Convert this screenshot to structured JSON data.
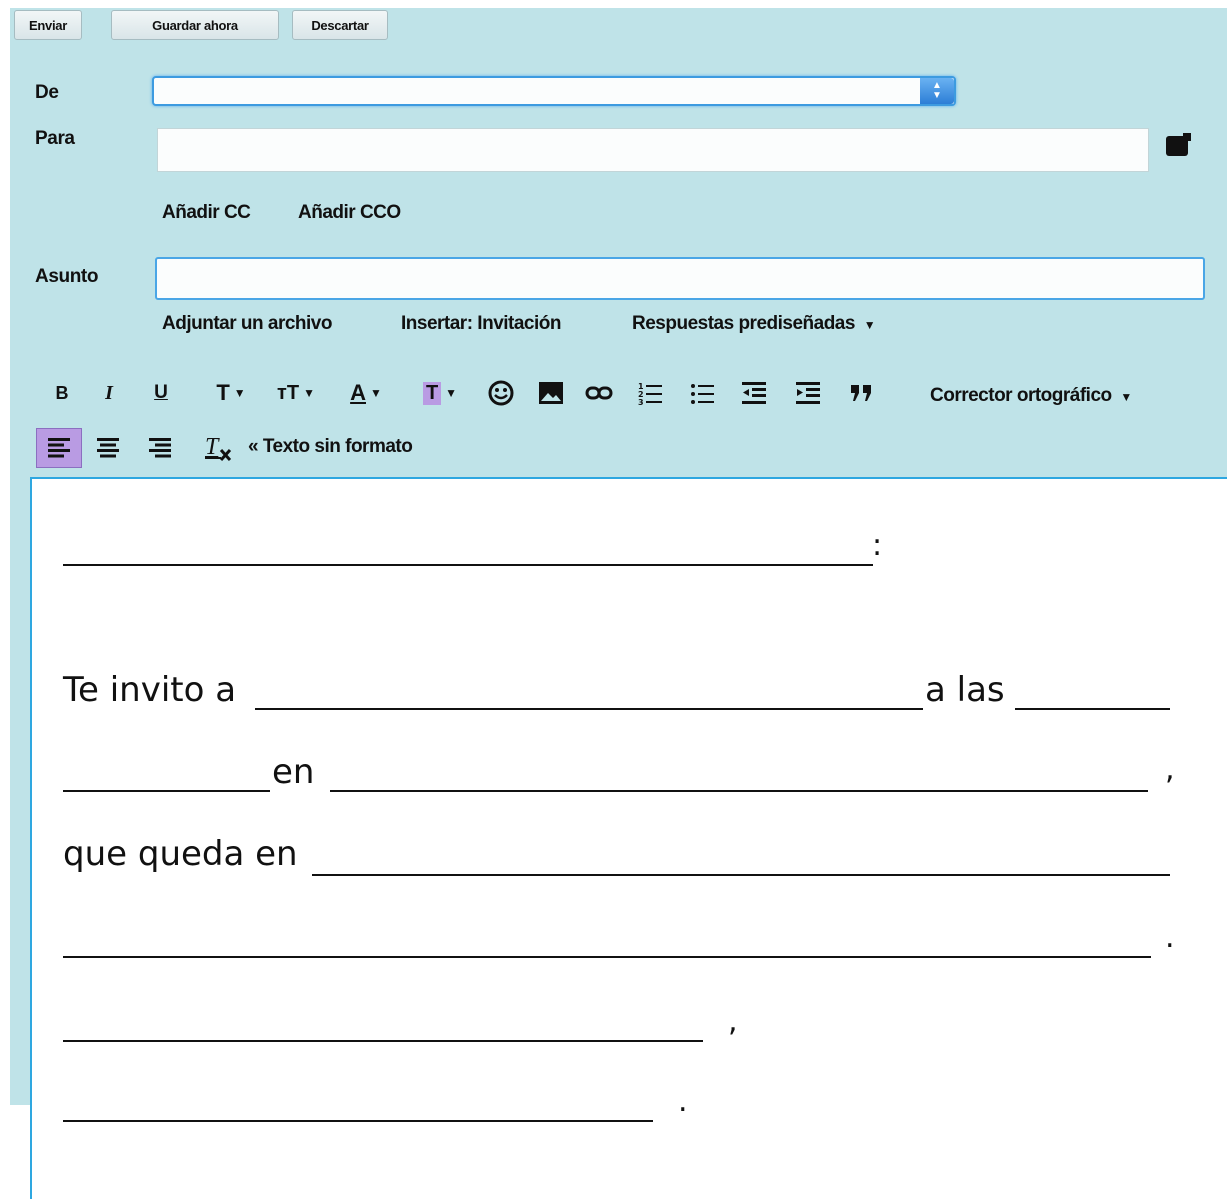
{
  "toolbar": {
    "send_label": "Enviar",
    "save_label": "Guardar ahora",
    "discard_label": "Descartar"
  },
  "fields": {
    "from_label": "De",
    "from_value": "",
    "to_label": "Para",
    "to_value": "",
    "subject_label": "Asunto",
    "subject_value": ""
  },
  "links": {
    "add_cc": "Añadir CC",
    "add_bcc": "Añadir CCO",
    "attach": "Adjuntar un archivo",
    "insert_invitation": "Insertar: Invitación",
    "canned_responses": "Respuestas prediseñadas"
  },
  "formatting": {
    "bold": "B",
    "italic": "I",
    "underline": "U",
    "font": "T",
    "font_size": "тT",
    "text_color": "A",
    "highlight": "T",
    "spell_check": "Corrector ortográfico",
    "plain_text": "« Texto sin formato",
    "active_alignment": "left"
  },
  "body": {
    "colon": ":",
    "invite_prefix": "Te invito a",
    "at_the": "a las",
    "in": "en",
    "comma1": ",",
    "located_in": "que queda en",
    "period1": ".",
    "comma2": ",",
    "period2": "."
  },
  "colors": {
    "panel_bg": "#bfe3e8",
    "focus_border": "#2ea7e0",
    "active_align_bg": "#b99be3"
  }
}
